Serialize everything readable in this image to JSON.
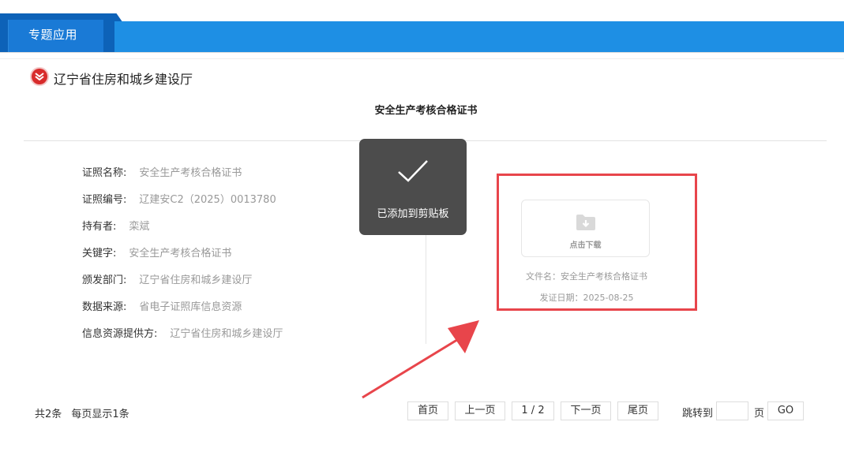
{
  "header": {
    "tab_label": "专题应用"
  },
  "department": {
    "name": "辽宁省住房和城乡建设厅"
  },
  "certificate": {
    "title": "安全生产考核合格证书",
    "fields": [
      {
        "label": "证照名称:",
        "value": "安全生产考核合格证书"
      },
      {
        "label": "证照编号:",
        "value": "辽建安C2（2025）0013780"
      },
      {
        "label": "持有者:",
        "value": "栾斌"
      },
      {
        "label": "关键字:",
        "value": "安全生产考核合格证书"
      },
      {
        "label": "颁发部门:",
        "value": "辽宁省住房和城乡建设厅"
      },
      {
        "label": "数据来源:",
        "value": "省电子证照库信息资源"
      },
      {
        "label": "信息资源提供方:",
        "value": "辽宁省住房和城乡建设厅"
      }
    ]
  },
  "toast": {
    "message": "已添加到剪贴板",
    "icon": "checkmark-icon"
  },
  "download": {
    "button_label": "点击下载",
    "icon": "folder-download-icon",
    "file_name": "文件名：安全生产考核合格证书",
    "issue_date": "发证日期：2025-08-25"
  },
  "pagination": {
    "total": "共2条",
    "per_page": "每页显示1条",
    "first": "首页",
    "prev": "上一页",
    "current": "1 / 2",
    "next": "下一页",
    "last": "尾页",
    "jump_to": "跳转到",
    "page_suffix": "页",
    "go": "GO",
    "jump_value": ""
  },
  "colors": {
    "header_blue": "#1e8fe4",
    "tab_blue": "#0d62b8",
    "highlight_red": "#e8454b",
    "toast_bg": "#4c4c4c"
  }
}
